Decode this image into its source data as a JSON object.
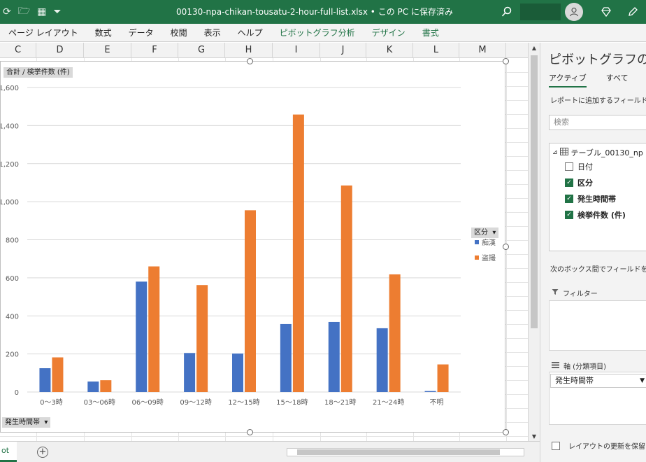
{
  "window": {
    "title": "00130-npa-chikan-tousatu-2-hour-full-list.xlsx • この PC に保存済み"
  },
  "ribbon": {
    "tabs": [
      {
        "label": "ページ レイアウト",
        "context": false
      },
      {
        "label": "数式",
        "context": false
      },
      {
        "label": "データ",
        "context": false
      },
      {
        "label": "校閲",
        "context": false
      },
      {
        "label": "表示",
        "context": false
      },
      {
        "label": "ヘルプ",
        "context": false
      },
      {
        "label": "ピボットグラフ分析",
        "context": true
      },
      {
        "label": "デザイン",
        "context": true
      },
      {
        "label": "書式",
        "context": true
      }
    ]
  },
  "grid": {
    "columns": [
      "C",
      "D",
      "E",
      "F",
      "G",
      "H",
      "I",
      "J",
      "K",
      "L",
      "M"
    ]
  },
  "chart_data": {
    "type": "bar",
    "categories": [
      "0～3時",
      "03～06時",
      "06～09時",
      "09～12時",
      "12～15時",
      "15～18時",
      "18～21時",
      "21～24時",
      "不明"
    ],
    "series": [
      {
        "name": "痴漢",
        "color": "#4472c4",
        "values": [
          125,
          55,
          580,
          205,
          202,
          357,
          368,
          335,
          5
        ]
      },
      {
        "name": "盗撮",
        "color": "#ed7d31",
        "values": [
          182,
          62,
          660,
          562,
          955,
          1458,
          1085,
          618,
          145
        ]
      }
    ],
    "ylim": [
      0,
      1600
    ],
    "yticks": [
      0,
      200,
      400,
      600,
      800,
      1000,
      1200,
      1400,
      1600
    ],
    "ytick_labels": [
      "0",
      "200",
      "400",
      "600",
      "800",
      "1,000",
      "1,200",
      "1,400",
      "1,600"
    ],
    "value_field_button": "合計 / 検挙件数 (件)",
    "axis_field_button": "発生時間帯",
    "legend_field_button": "区分",
    "legend_position": "right",
    "grid": true
  },
  "sheet_tab": {
    "label": "ot"
  },
  "pane": {
    "title": "ピボットグラフのフィ",
    "tab_active": "アクティブ",
    "tab_all": "すべて",
    "hint": "レポートに追加するフィールドを選",
    "search_placeholder": "検索",
    "table_name": "テーブル_00130_np",
    "fields": [
      {
        "label": "日付",
        "checked": false
      },
      {
        "label": "区分",
        "checked": true
      },
      {
        "label": "発生時間帯",
        "checked": true
      },
      {
        "label": "検挙件数 (件)",
        "checked": true
      }
    ],
    "drag_hint": "次のボックス間でフィールドをドラ",
    "filter_label": "フィルター",
    "axis_label": "軸 (分類項目)",
    "axis_item": "発生時間帯",
    "defer_label": "レイアウトの更新を保留す"
  }
}
